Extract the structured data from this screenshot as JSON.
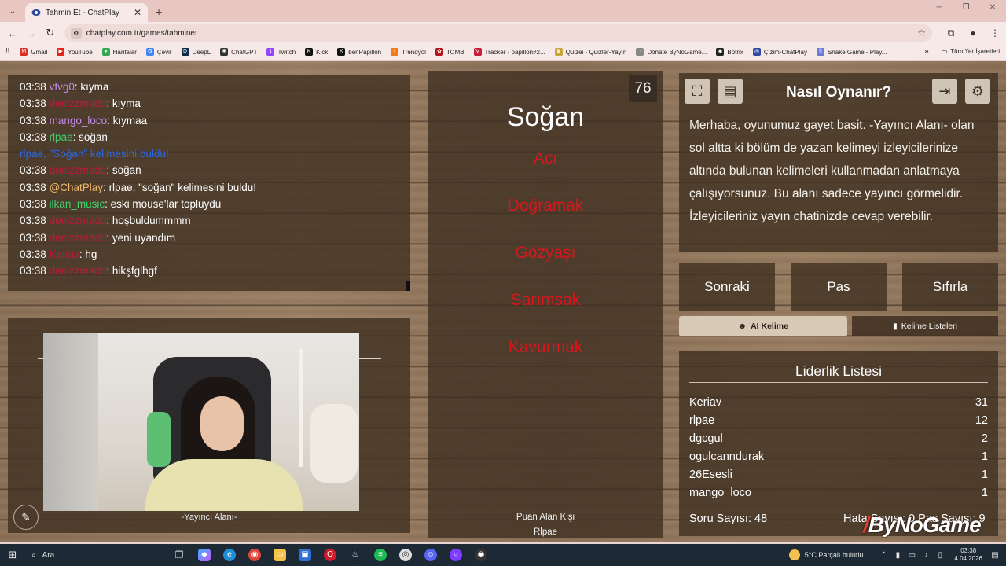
{
  "browser": {
    "tab_title": "Tahmin Et - ChatPlay",
    "url": "chatplay.com.tr/games/tahminet",
    "bookmarks": [
      "Gmail",
      "YouTube",
      "Haritalar",
      "Çevir",
      "DeepL",
      "ChatGPT",
      "Twitch",
      "Kick",
      "benPapillon",
      "Trendyol",
      "TCMB",
      "Tracker - papillon#2...",
      "Quizei - Quizler-Yayın",
      "Donate ByNoGame...",
      "Botrix",
      "Çizim-ChatPlay",
      "Snake Game - Play..."
    ],
    "bookmarks_more": "»",
    "all_bookmarks": "Tüm Yer İşaretleri"
  },
  "chat": {
    "messages": [
      {
        "time": "03:38",
        "user": "vfvg0",
        "color": "#c48ce8",
        "sep": ": ",
        "text": "kıyma"
      },
      {
        "time": "03:38",
        "user": "denizzmadd",
        "color": "#c4163a",
        "sep": ": ",
        "text": "kıyma"
      },
      {
        "time": "03:38",
        "user": "mango_loco",
        "color": "#c48ce8",
        "sep": ": ",
        "text": "kıymaa"
      },
      {
        "time": "03:38",
        "user": "rlpae",
        "color": "#3ed16e",
        "sep": ": ",
        "text": "soğan"
      },
      {
        "time": "",
        "user": "rlpae, \"Soğan\" kelimesini buldu!",
        "color": "#2d68e0",
        "sep": "",
        "text": ""
      },
      {
        "time": "03:38",
        "user": "denizzmadd",
        "color": "#c4163a",
        "sep": ": ",
        "text": "soğan"
      },
      {
        "time": "03:38",
        "user": "@ChatPlay",
        "color": "#f0b86a",
        "sep": ": ",
        "text": "rlpae, \"soğan\" kelimesini buldu!"
      },
      {
        "time": "03:38",
        "user": "ilkan_music",
        "color": "#3ed16e",
        "sep": ": ",
        "text": "eski mouse'lar topluydu"
      },
      {
        "time": "03:38",
        "user": "denizzmadd",
        "color": "#c4163a",
        "sep": ": ",
        "text": "hoşbuldummmm"
      },
      {
        "time": "03:38",
        "user": "denizzmadd",
        "color": "#c4163a",
        "sep": ": ",
        "text": "yeni uyandım"
      },
      {
        "time": "03:38",
        "user": "Keriav",
        "color": "#c4163a",
        "sep": ": ",
        "text": "hg"
      },
      {
        "time": "03:38",
        "user": "denizzmadd",
        "color": "#c4163a",
        "sep": ": ",
        "text": "hikşfglhgf"
      }
    ]
  },
  "streamer": {
    "label": "-Yayıncı Alanı-"
  },
  "card": {
    "timer": "76",
    "word": "Soğan",
    "forbidden": [
      "Acı",
      "Doğramak",
      "Gözyaşı",
      "Sarımsak",
      "Kavurmak"
    ],
    "scorer_label": "Puan Alan Kişi",
    "scorer_name": "Rlpae"
  },
  "howto": {
    "title": "Nasıl Oynanır?",
    "text": "Merhaba, oyunumuz gayet basit. -Yayıncı Alanı- olan sol altta ki bölüm de yazan kelimeyi izleyicilerinize altında bulunan kelimeleri kullanmadan anlatmaya çalışıyorsunuz. Bu alanı sadece yayıncı görmelidir. İzleyicileriniz yayın chatinizde cevap verebilir."
  },
  "actions": {
    "next": "Sonraki",
    "pass": "Pas",
    "reset": "Sıfırla"
  },
  "sub": {
    "ai": "AI Kelime",
    "lists": "Kelime Listeleri"
  },
  "leaderboard": {
    "title": "Liderlik Listesi",
    "rows": [
      {
        "name": "Keriav",
        "score": "31"
      },
      {
        "name": "rlpae",
        "score": "12"
      },
      {
        "name": "dgcgul",
        "score": "2"
      },
      {
        "name": "ogulcanndurak",
        "score": "1"
      },
      {
        "name": "26Esesli",
        "score": "1"
      },
      {
        "name": "mango_loco",
        "score": "1"
      }
    ],
    "questions_label": "Soru Sayısı: 48",
    "right_footer": "Hata Sayısı: 0  Pas Sayısı: 9"
  },
  "watermark": "ByNoGame",
  "taskbar": {
    "search": "Ara",
    "weather": "5°C  Parçalı bulutlu",
    "time": "03:38",
    "date": "4.04.2026"
  }
}
